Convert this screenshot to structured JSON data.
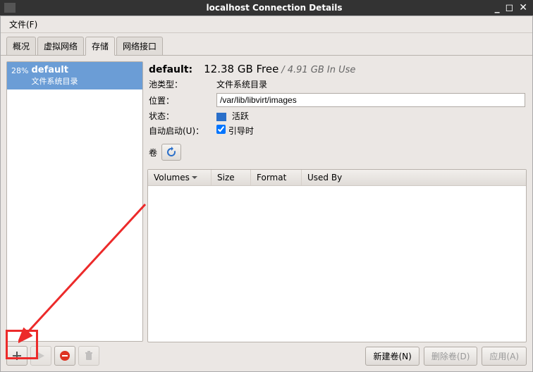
{
  "window": {
    "title": "localhost Connection Details"
  },
  "menu": {
    "file": "文件(F)"
  },
  "tabs": {
    "overview": "概况",
    "virtnet": "虚拟网络",
    "storage": "存储",
    "netiface": "网络接口"
  },
  "pool": {
    "percent": "28%",
    "name": "default",
    "type_label": "文件系统目录"
  },
  "details": {
    "name": "default:",
    "free": "12.38 GB Free",
    "inuse": "/ 4.91 GB In Use",
    "pooltype_label": "池类型：",
    "pooltype_value": "文件系统目录",
    "location_label": "位置：",
    "location_value": "/var/lib/libvirt/images",
    "state_label": "状态：",
    "state_value": "活跃",
    "autostart_label": "自动启动(U)：",
    "autostart_value": "引导时",
    "volumes_label": "卷"
  },
  "columns": {
    "volumes": "Volumes",
    "size": "Size",
    "format": "Format",
    "usedby": "Used By"
  },
  "buttons": {
    "newvol": "新建卷(N)",
    "delvol": "删除卷(D)",
    "apply": "应用(A)"
  }
}
